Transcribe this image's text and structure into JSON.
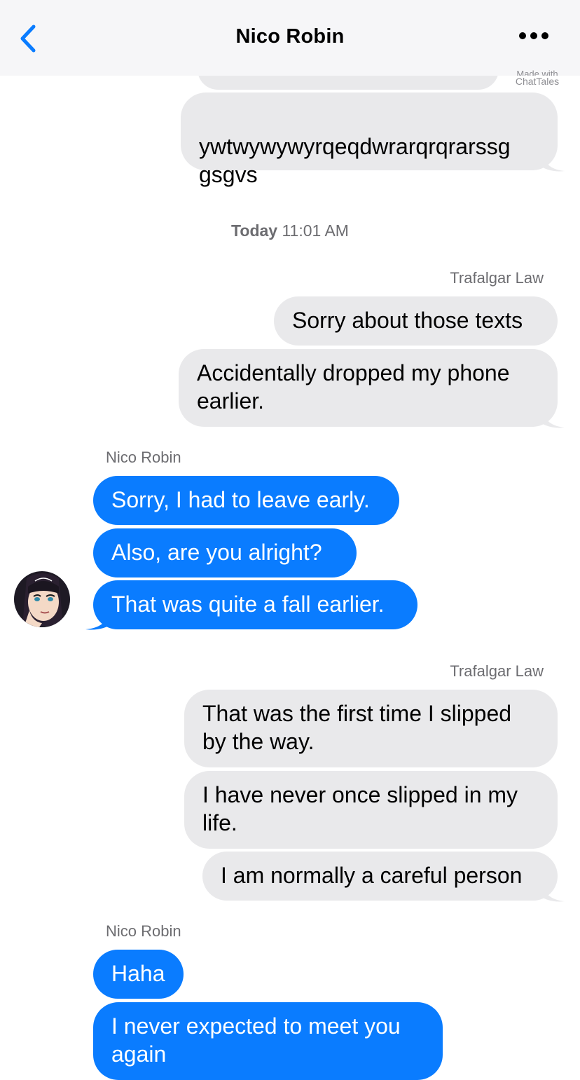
{
  "header": {
    "title": "Nico Robin",
    "back_icon": "chevron-left-icon",
    "more_icon": "ellipsis-icon",
    "accent": "#0a7cff"
  },
  "watermark": {
    "line1": "Made with",
    "line2": "ChatTales"
  },
  "timestamp": {
    "day": "Today",
    "time": "11:01 AM"
  },
  "senders": {
    "law": "Trafalgar Law",
    "robin": "Nico Robin"
  },
  "messages": [
    {
      "from": "law",
      "text": "ywtwywywyrqeqdwrarqrqrarssg\ngsgvs"
    },
    {
      "from": "law",
      "text": "Sorry about those texts"
    },
    {
      "from": "law",
      "text": "Accidentally dropped my phone earlier."
    },
    {
      "from": "robin",
      "text": "Sorry, I had to leave early."
    },
    {
      "from": "robin",
      "text": "Also, are you alright?"
    },
    {
      "from": "robin",
      "text": "That was quite a fall earlier."
    },
    {
      "from": "law",
      "text": "That was the first time I slipped by the way."
    },
    {
      "from": "law",
      "text": "I have never once slipped in my life."
    },
    {
      "from": "law",
      "text": "I am normally a careful person"
    },
    {
      "from": "robin",
      "text": "Haha"
    },
    {
      "from": "robin",
      "text": "I never expected to meet you again"
    }
  ],
  "colors": {
    "incoming_bubble": "#e9e9eb",
    "outgoing_bubble": "#0a7cff"
  }
}
